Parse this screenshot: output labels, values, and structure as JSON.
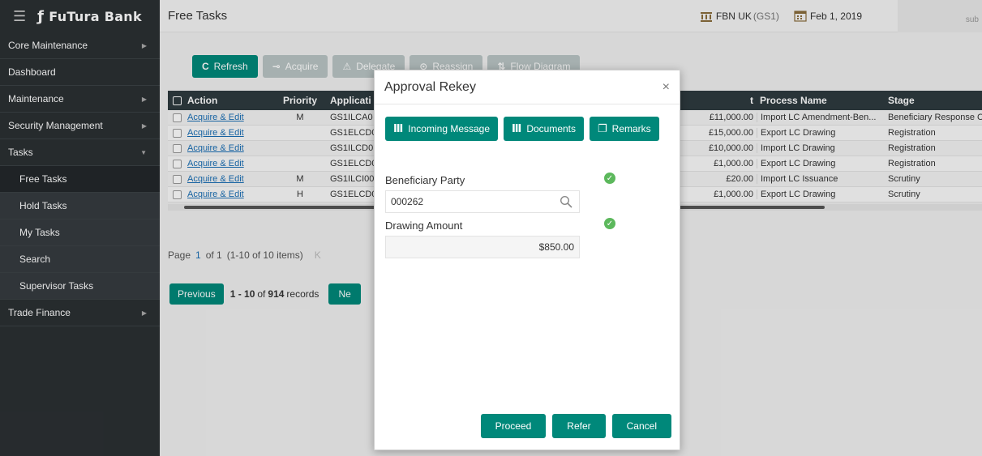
{
  "brand": {
    "name": "FuTura Bank"
  },
  "sidebar": {
    "items": [
      {
        "label": "Core Maintenance",
        "caret": "▶"
      },
      {
        "label": "Dashboard",
        "caret": ""
      },
      {
        "label": "Maintenance",
        "caret": "▶"
      },
      {
        "label": "Security Management",
        "caret": "▶"
      },
      {
        "label": "Tasks",
        "caret": "▼"
      },
      {
        "label": "Free Tasks",
        "caret": ""
      },
      {
        "label": "Hold Tasks",
        "caret": ""
      },
      {
        "label": "My Tasks",
        "caret": ""
      },
      {
        "label": "Search",
        "caret": ""
      },
      {
        "label": "Supervisor Tasks",
        "caret": ""
      },
      {
        "label": "Trade Finance",
        "caret": "▶"
      }
    ]
  },
  "header": {
    "title": "Free Tasks",
    "bank": "FBN UK",
    "branch": "(GS1)",
    "date": "Feb 1, 2019",
    "user": "sub"
  },
  "toolbar": {
    "refresh": "Refresh",
    "acquire": "Acquire",
    "delegate": "Delegate",
    "reassign": "Reassign",
    "flow": "Flow Diagram"
  },
  "grid": {
    "columns": {
      "action": "Action",
      "priority": "Priority",
      "app": "Applicati",
      "amount": "t",
      "process": "Process Name",
      "stage": "Stage"
    },
    "rows": [
      {
        "action": "Acquire & Edit",
        "priority": "M",
        "app": "GS1ILCA0",
        "amount": "£11,000.00",
        "process": "Import LC Amendment-Ben...",
        "stage": "Beneficiary Response C"
      },
      {
        "action": "Acquire & Edit",
        "priority": "",
        "app": "GS1ELCD0",
        "amount": "£15,000.00",
        "process": "Export LC Drawing",
        "stage": "Registration"
      },
      {
        "action": "Acquire & Edit",
        "priority": "",
        "app": "GS1ILCD0",
        "amount": "£10,000.00",
        "process": "Import LC Drawing",
        "stage": "Registration"
      },
      {
        "action": "Acquire & Edit",
        "priority": "",
        "app": "GS1ELCD0",
        "amount": "£1,000.00",
        "process": "Export LC Drawing",
        "stage": "Registration"
      },
      {
        "action": "Acquire & Edit",
        "priority": "M",
        "app": "GS1ILCI00",
        "amount": "£20.00",
        "process": "Import LC Issuance",
        "stage": "Scrutiny"
      },
      {
        "action": "Acquire & Edit",
        "priority": "H",
        "app": "GS1ELCD0",
        "amount": "£1,000.00",
        "process": "Export LC Drawing",
        "stage": "Scrutiny"
      }
    ]
  },
  "pager": {
    "page_label": "Page",
    "page": "1",
    "of_text": "of 1",
    "items_text": "(1-10 of 10 items)",
    "first_symbol": "K"
  },
  "records": {
    "previous": "Previous",
    "range": "1 - 10",
    "of": "of",
    "total": "914",
    "suffix": "records",
    "next": "Ne"
  },
  "modal": {
    "title": "Approval Rekey",
    "close": "×",
    "tabs": {
      "incoming": "Incoming Message",
      "documents": "Documents",
      "remarks": "Remarks"
    },
    "beneficiary_label": "Beneficiary Party",
    "beneficiary_value": "000262",
    "drawing_label": "Drawing Amount",
    "drawing_value": "$850.00",
    "proceed": "Proceed",
    "refer": "Refer",
    "cancel": "Cancel"
  },
  "colors": {
    "accent": "#00887a",
    "sidebar": "#2b3033",
    "grid_header": "#2e3a3f",
    "success": "#5cb85c"
  }
}
